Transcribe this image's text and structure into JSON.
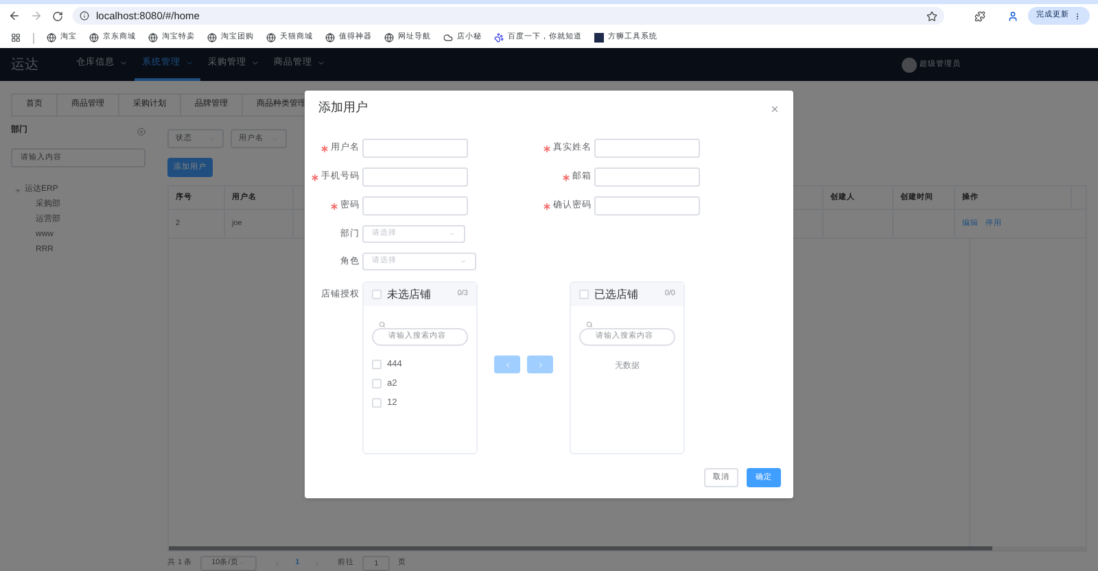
{
  "browser": {
    "url": "localhost:8080/#/home",
    "update_button": "完成更新",
    "bookmarks": [
      {
        "label": "淘宝",
        "kind": "globe"
      },
      {
        "label": "京东商城",
        "kind": "globe"
      },
      {
        "label": "淘宝特卖",
        "kind": "globe"
      },
      {
        "label": "淘宝团购",
        "kind": "globe"
      },
      {
        "label": "天猫商城",
        "kind": "globe"
      },
      {
        "label": "值得神器",
        "kind": "globe"
      },
      {
        "label": "网址导航",
        "kind": "globe"
      },
      {
        "label": "店小秘",
        "kind": "cloud"
      },
      {
        "label": "百度一下，你就知道",
        "kind": "paw"
      },
      {
        "label": "方狮工具系统",
        "kind": "square"
      }
    ]
  },
  "nav": {
    "logo": "运达",
    "items": [
      {
        "label": "仓库信息",
        "selected": false
      },
      {
        "label": "系统管理",
        "selected": true
      },
      {
        "label": "采购管理",
        "selected": false
      },
      {
        "label": "商品管理",
        "selected": false
      }
    ],
    "user": "超级管理员"
  },
  "tags": [
    "首页",
    "商品管理",
    "采购计划",
    "品牌管理",
    "商品种类管理"
  ],
  "department_panel": {
    "title": "部门",
    "search": {
      "placeholder": "请输入内容"
    },
    "tree": [
      {
        "label": "运达ERP",
        "expanded": true,
        "children": [
          {
            "label": "采购部"
          },
          {
            "label": "运营部"
          },
          {
            "label": "www"
          },
          {
            "label": "RRR"
          }
        ]
      }
    ]
  },
  "filters": [
    {
      "placeholder": "状态"
    },
    {
      "placeholder": "用户名"
    }
  ],
  "add_button": "添加用户",
  "table": {
    "columns": [
      "序号",
      "用户名",
      "创建人",
      "创建时间",
      "操作"
    ],
    "rows": [
      {
        "index": "2",
        "username": "joe",
        "actions": [
          "编辑",
          "停用"
        ]
      }
    ]
  },
  "pagination": {
    "total": "共 1 条",
    "page_size": "10条/页",
    "pages": [
      {
        "label": "1",
        "selected": true
      }
    ],
    "goto_label": "前往",
    "goto_value": "1",
    "goto_suffix": "页"
  },
  "dialog": {
    "title": "添加用户",
    "fields": [
      {
        "label": "用户名",
        "required": true
      },
      {
        "label": "真实姓名",
        "required": true
      },
      {
        "label": "手机号码",
        "required": true
      },
      {
        "label": "邮箱",
        "required": true
      },
      {
        "label": "密码",
        "required": true
      },
      {
        "label": "确认密码",
        "required": true
      }
    ],
    "selects": [
      {
        "label": "部门",
        "placeholder": "请选择"
      },
      {
        "label": "角色",
        "placeholder": "请选择"
      }
    ],
    "transfer": {
      "label": "店铺授权",
      "source": {
        "title": "未选店铺",
        "count": "0/3",
        "checked": false,
        "search_placeholder": "请输入搜索内容",
        "items": [
          {
            "label": "444",
            "checked": false
          },
          {
            "label": "a2",
            "checked": false
          },
          {
            "label": "12",
            "checked": false
          }
        ]
      },
      "target": {
        "title": "已选店铺",
        "count": "0/0",
        "checked": false,
        "search_placeholder": "请输入搜索内容",
        "empty_text": "无数据"
      },
      "buttons": [
        {
          "kind": "left",
          "disabled": true
        },
        {
          "kind": "right",
          "disabled": true
        }
      ]
    },
    "actions": [
      {
        "label": "取消",
        "kind": "default"
      },
      {
        "label": "确定",
        "kind": "primary"
      }
    ]
  }
}
